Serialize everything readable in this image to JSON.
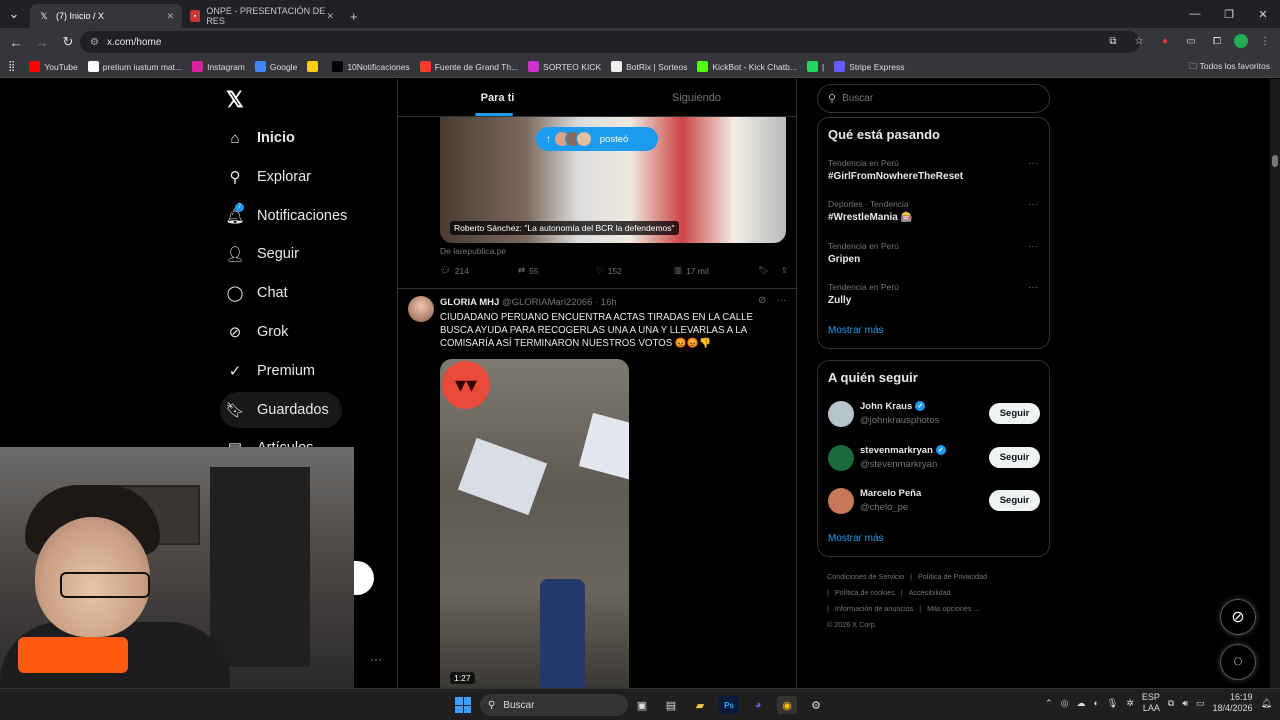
{
  "browser": {
    "tabs": [
      {
        "label": "(7) Inicio / X",
        "active": true,
        "favicon": "x-icon"
      },
      {
        "label": "ONPE - PRESENTACIÓN DE RES",
        "active": false,
        "favicon": "onpe-icon"
      }
    ],
    "url": "x.com/home",
    "bookmarks": [
      {
        "label": "YouTube",
        "color": "#ff0000",
        "icon": "youtube-icon"
      },
      {
        "label": "pretium iustum mat...",
        "color": "#ffffff",
        "icon": "globe-icon"
      },
      {
        "label": "Instagram",
        "color": "#d6249f",
        "icon": "instagram-icon"
      },
      {
        "label": "Google",
        "color": "#4285f4",
        "icon": "google-icon"
      },
      {
        "label": "",
        "color": "#ffd000",
        "icon": "puzzle-icon"
      },
      {
        "label": "10Notificaciones",
        "color": "#000000",
        "icon": "x-icon"
      },
      {
        "label": "Fuente de Grand Th...",
        "color": "#ff3b30",
        "icon": "font-icon"
      },
      {
        "label": "SORTEO KICK",
        "color": "#cc33cc",
        "icon": "kick-icon"
      },
      {
        "label": "BotRix | Sorteos",
        "color": "#eeeeee",
        "icon": "botrix-icon"
      },
      {
        "label": "KickBot - Kick Chatb...",
        "color": "#53fc18",
        "icon": "kickbot-icon"
      },
      {
        "label": "|",
        "color": "#25d366",
        "icon": "whatsapp-icon"
      },
      {
        "label": "Stripe Express",
        "color": "#635bff",
        "icon": "stripe-icon"
      }
    ],
    "all_bookmarks": "Todos los favoritos"
  },
  "sidebar": {
    "items": [
      {
        "label": "Inicio",
        "icon": "home-icon",
        "bold": true
      },
      {
        "label": "Explorar",
        "icon": "search-icon"
      },
      {
        "label": "Notificaciones",
        "icon": "bell-icon",
        "badge": "7"
      },
      {
        "label": "Seguir",
        "icon": "add-user-icon"
      },
      {
        "label": "Chat",
        "icon": "chat-icon"
      },
      {
        "label": "Grok",
        "icon": "grok-icon"
      },
      {
        "label": "Premium",
        "icon": "premium-icon"
      },
      {
        "label": "Guardados",
        "icon": "bookmark-icon"
      },
      {
        "label": "Artículos",
        "icon": "article-icon"
      }
    ]
  },
  "feed": {
    "tabs": [
      "Para ti",
      "Siguiendo"
    ],
    "new_posts_pill": "posteó",
    "post1": {
      "media_caption": "Roberto Sánchez: \"La autonomía del BCR la defendemos\"",
      "source": "De larepublica.pe",
      "replies": "214",
      "reposts": "55",
      "likes": "152",
      "views": "17 mil"
    },
    "post2": {
      "name": "GLORIA MHJ",
      "handle": "@GLORIAMari22066",
      "time": "· 16h",
      "text": "CIUDADANO PERUANO ENCUENTRA ACTAS TIRADAS EN LA CALLE BUSCA AYUDA PARA RECOGERLAS UNA A UNA Y LLEVARLAS A LA COMISARÍA ASÍ TERMINARON NUESTROS VOTOS 😡😡👎",
      "duration": "1:27"
    }
  },
  "right": {
    "search_placeholder": "Buscar",
    "trending_title": "Qué está pasando",
    "trends": [
      {
        "meta": "Tendencia en Perú",
        "name": "#GirlFromNowhereTheReset"
      },
      {
        "meta": "Deportes · Tendencia",
        "name": "#WrestleMania 🎰"
      },
      {
        "meta": "Tendencia en Perú",
        "name": "Gripen"
      },
      {
        "meta": "Tendencia en Perú",
        "name": "Zully"
      }
    ],
    "show_more": "Mostrar más",
    "follow_title": "A quién seguir",
    "follow": [
      {
        "name": "John Kraus",
        "handle": "@johnkrausphotos",
        "button": "Seguir",
        "avatar_color": "#b8c4cc"
      },
      {
        "name": "stevenmarkryan",
        "handle": "@stevenmarkryan",
        "button": "Seguir",
        "avatar_color": "#1a6a3a"
      },
      {
        "name": "Marcelo Peña",
        "handle": "@chelo_pe",
        "button": "Seguir",
        "avatar_color": "#c8785a"
      }
    ],
    "footer": [
      "Condiciones de Servicio",
      "|",
      "Política de Privacidad",
      "|",
      "Política de cookies",
      "|",
      "Accesibilidad",
      "|",
      "Información de anuncios",
      "|",
      "Más opciones ...",
      "© 2026 X Corp."
    ]
  },
  "taskbar": {
    "search": "Buscar",
    "lang": "ESP",
    "lang2": "LAA",
    "time": "16:19",
    "date": "18/4/2026"
  }
}
